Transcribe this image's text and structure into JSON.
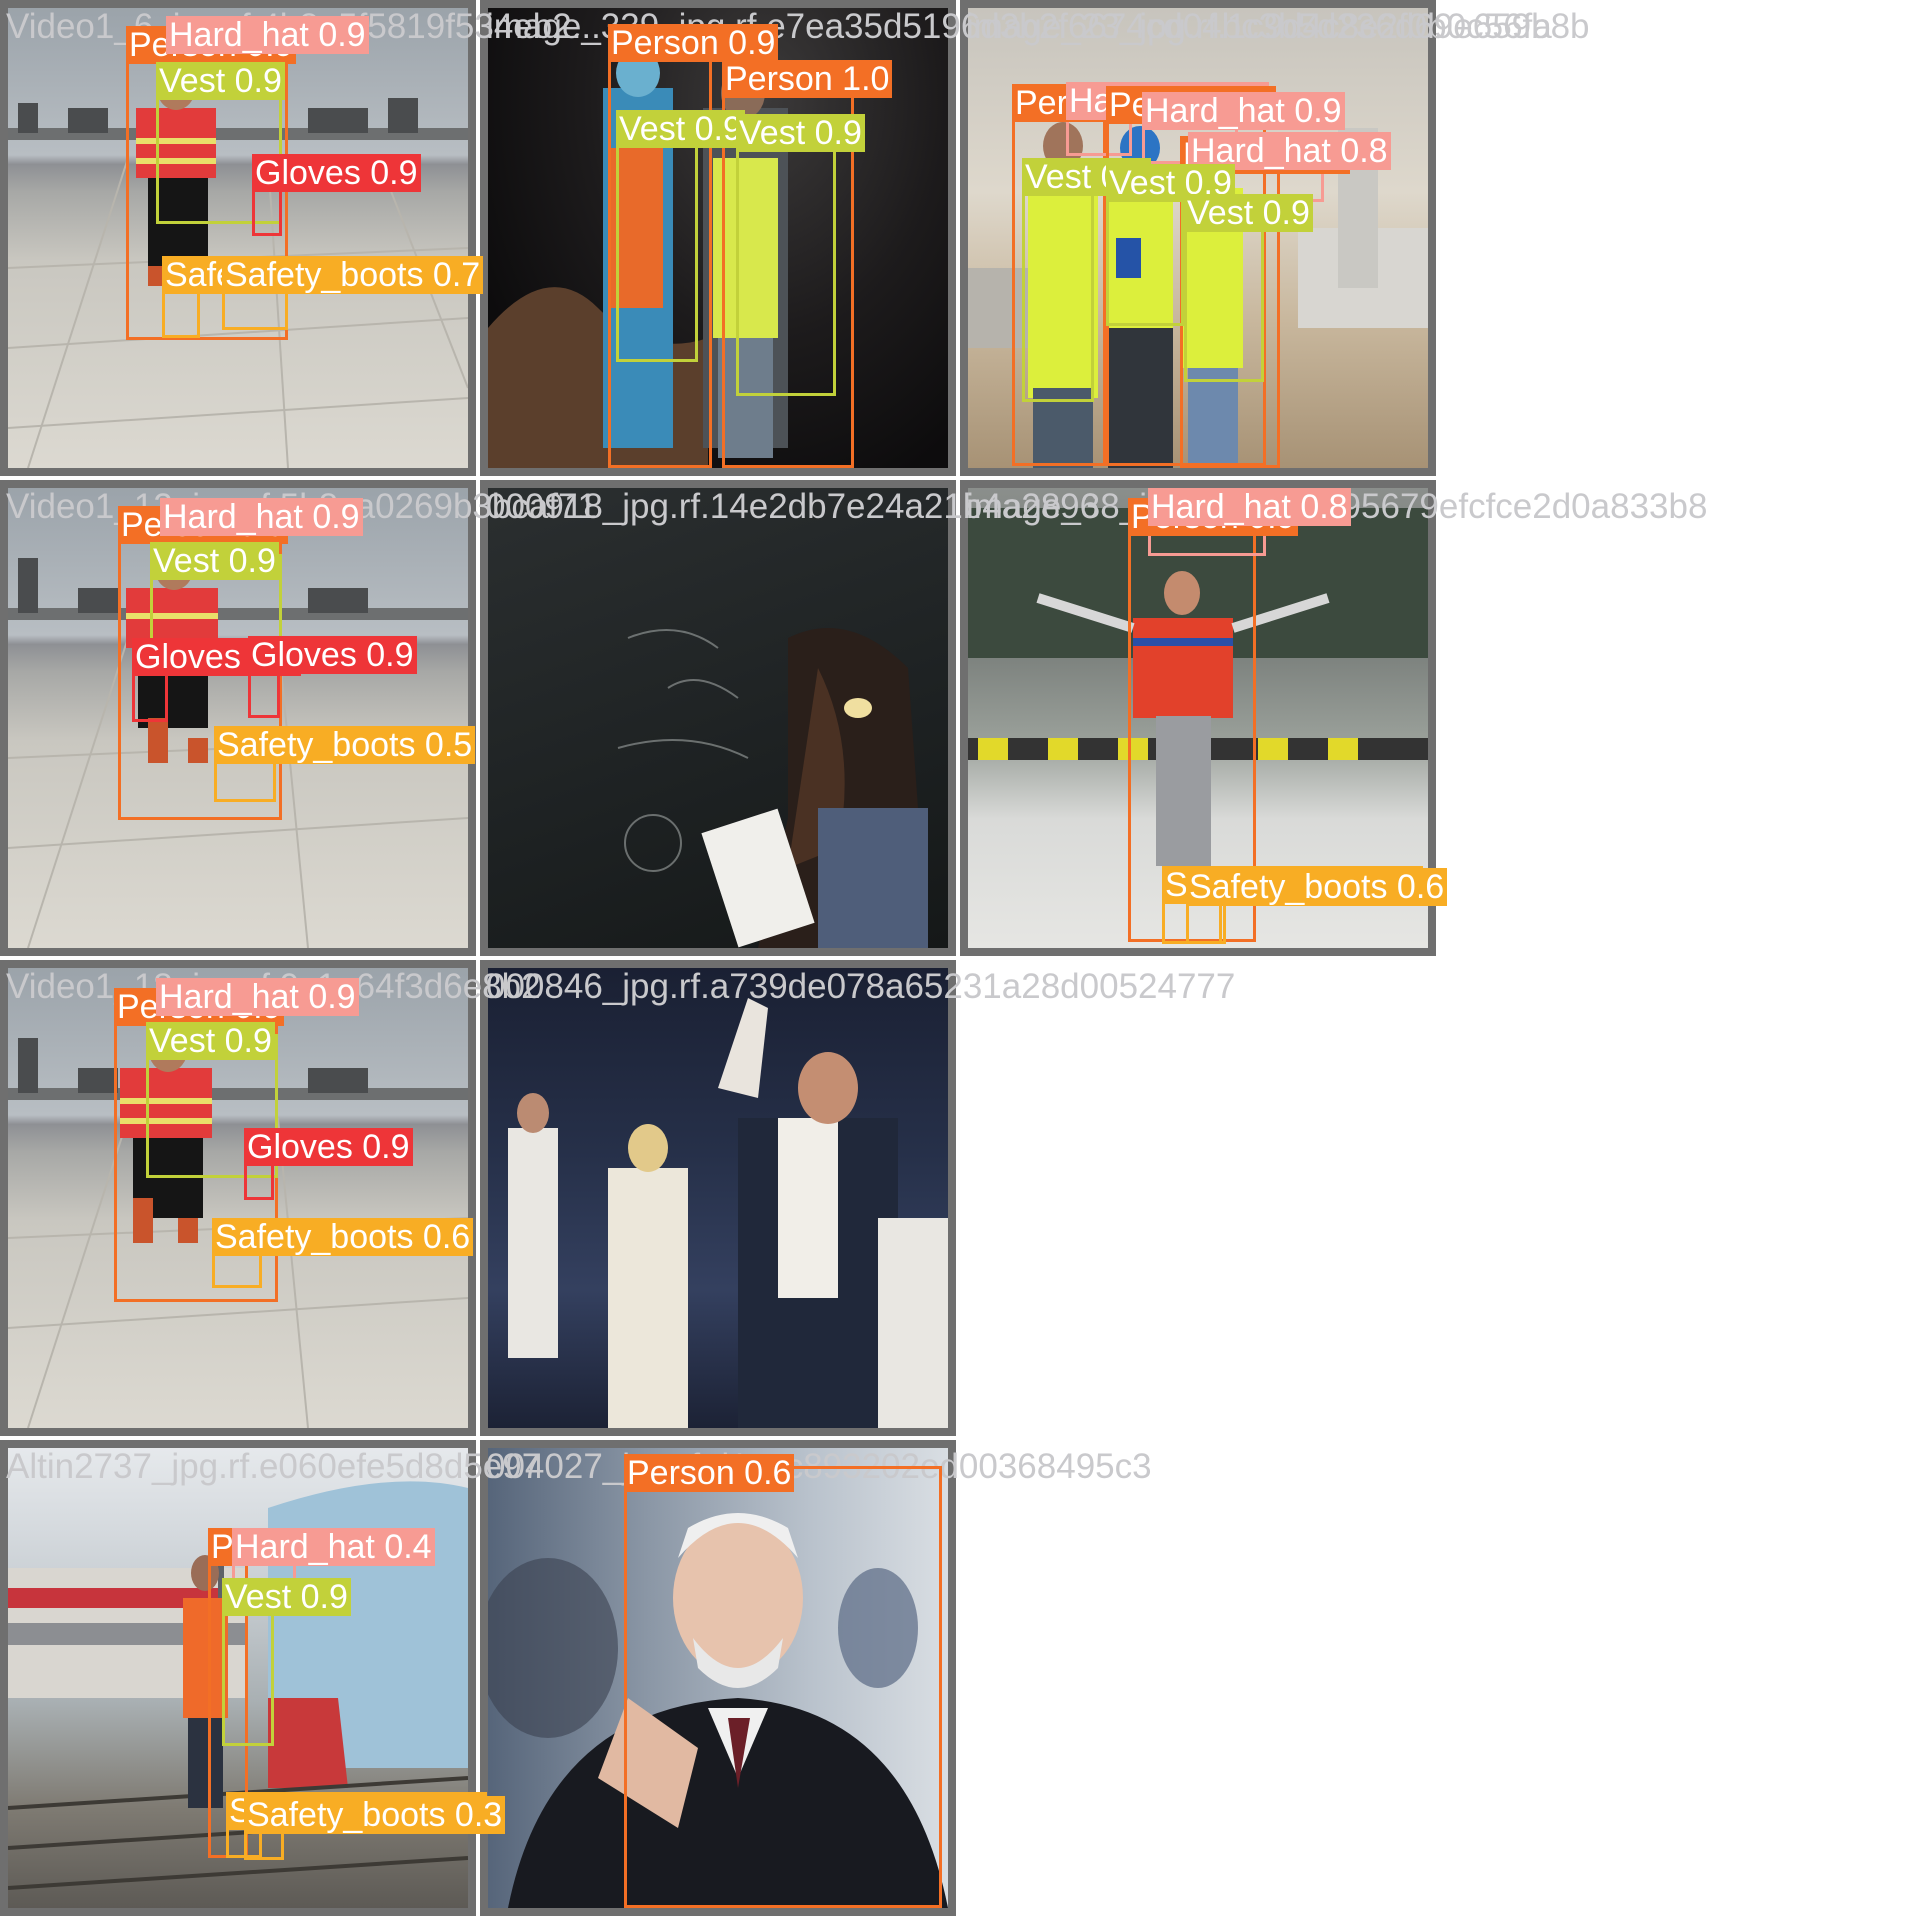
{
  "tiles": [
    {
      "filename": "Video1_6_jpg.rf.4b8e5f5819f534eb2...",
      "detections": [
        {
          "label": "Person 0.9",
          "cls": "person"
        },
        {
          "label": "Hard_hat 0.9",
          "cls": "hard_hat"
        },
        {
          "label": "Vest 0.9",
          "cls": "vest"
        },
        {
          "label": "Gloves 0.9",
          "cls": "gloves"
        },
        {
          "label": "Safety_boots 0.3",
          "cls": "boots"
        },
        {
          "label": "Safety_boots 0.7",
          "cls": "boots"
        }
      ]
    },
    {
      "filename": "image_339_jpg.rf.e7ea35d5196d3b2f6674cd04bc3b5d236d69e659b8b",
      "detections": [
        {
          "label": "Person 0.9",
          "cls": "person"
        },
        {
          "label": "Person 1.0",
          "cls": "person"
        },
        {
          "label": "Vest 0.9",
          "cls": "vest"
        },
        {
          "label": "Vest 0.9",
          "cls": "vest"
        }
      ]
    },
    {
      "filename": "image_23_jpg.rf.1c9d4c8e2f0b0c56fa",
      "detections": [
        {
          "label": "Person 0.9",
          "cls": "person"
        },
        {
          "label": "Hard_hat 0.9",
          "cls": "hard_hat"
        },
        {
          "label": "Person 0.8",
          "cls": "person"
        },
        {
          "label": "Hard_hat 0.9",
          "cls": "hard_hat"
        },
        {
          "label": "Person 0.8",
          "cls": "person"
        },
        {
          "label": "Hard_hat 0.8",
          "cls": "hard_hat"
        },
        {
          "label": "Vest 0.9",
          "cls": "vest"
        },
        {
          "label": "Vest 0.9",
          "cls": "vest"
        },
        {
          "label": "Vest 0.9",
          "cls": "vest"
        }
      ]
    },
    {
      "filename": "Video1_12_jpg.rf.5b8ca0269b3bcaf71",
      "detections": [
        {
          "label": "Person 0.9",
          "cls": "person"
        },
        {
          "label": "Hard_hat 0.9",
          "cls": "hard_hat"
        },
        {
          "label": "Vest 0.9",
          "cls": "vest"
        },
        {
          "label": "Gloves 0.5",
          "cls": "gloves"
        },
        {
          "label": "Gloves 0.9",
          "cls": "gloves"
        },
        {
          "label": "Safety_boots 0.5",
          "cls": "boots"
        }
      ]
    },
    {
      "filename": "000918_jpg.rf.14e2db7e24a21b4a2896",
      "detections": []
    },
    {
      "filename": "image_38_jpg.rf.c1884495679efcfce2d0a833b8",
      "detections": [
        {
          "label": "Person 0.9",
          "cls": "person"
        },
        {
          "label": "Hard_hat 0.8",
          "cls": "hard_hat"
        },
        {
          "label": "Safety_boots 0.8",
          "cls": "boots"
        },
        {
          "label": "Safety_boots 0.6",
          "cls": "boots"
        }
      ]
    },
    {
      "filename": "Video1_18_jpg.rf.9c1a64f3d6e8b2",
      "detections": [
        {
          "label": "Person 0.9",
          "cls": "person"
        },
        {
          "label": "Hard_hat 0.9",
          "cls": "hard_hat"
        },
        {
          "label": "Vest 0.9",
          "cls": "vest"
        },
        {
          "label": "Gloves 0.9",
          "cls": "gloves"
        },
        {
          "label": "Safety_boots 0.6",
          "cls": "boots"
        }
      ]
    },
    {
      "filename": "000846_jpg.rf.a739de078a65231a28d00524777",
      "detections": []
    },
    {
      "filename": "Altin2737_jpg.rf.e060efe5d8d5e97",
      "detections": [
        {
          "label": "Person 0.9",
          "cls": "person"
        },
        {
          "label": "Hard_hat 0.4",
          "cls": "hard_hat"
        },
        {
          "label": "Vest 0.9",
          "cls": "vest"
        },
        {
          "label": "Safety_boots 0.3",
          "cls": "boots"
        },
        {
          "label": "Safety_boots 0.3",
          "cls": "boots"
        }
      ]
    },
    {
      "filename": "004027_jpg.rf.d1ecc893202ed00368495c3",
      "detections": [
        {
          "label": "Person 0.6",
          "cls": "person"
        }
      ]
    }
  ],
  "colors": {
    "person": "#f36f25",
    "hard_hat": "#f79b93",
    "vest": "#c2d13a",
    "gloves": "#ee3538",
    "boots": "#f8ad24"
  }
}
